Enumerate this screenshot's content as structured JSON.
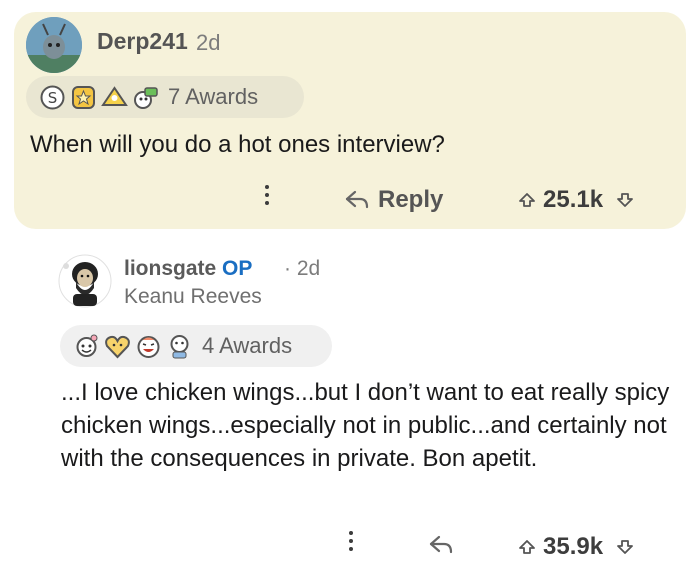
{
  "comment1": {
    "author": "Derp241",
    "age": "2d",
    "awards_label": "7 Awards",
    "text": "When will you do a hot ones interview?",
    "reply_label": "Reply",
    "score": "25.1k"
  },
  "comment2": {
    "author": "lionsgate",
    "op_tag": "OP",
    "separator": "·",
    "age": "2d",
    "flair": "Keanu Reeves",
    "awards_label": "4 Awards",
    "text": "...I love chicken wings...but I don’t want to eat really spicy chicken wings...especially not in public...and certainly not with the consequences in private. Bon apetit.",
    "score": "35.9k"
  },
  "colors": {
    "highlight_bg": "#f6f2da",
    "op_blue": "#1a6ec2",
    "text_dark": "#1a1a1b"
  },
  "icons": [
    "more-options-icon",
    "reply-icon",
    "upvote-icon",
    "downvote-icon",
    "award-icon"
  ]
}
